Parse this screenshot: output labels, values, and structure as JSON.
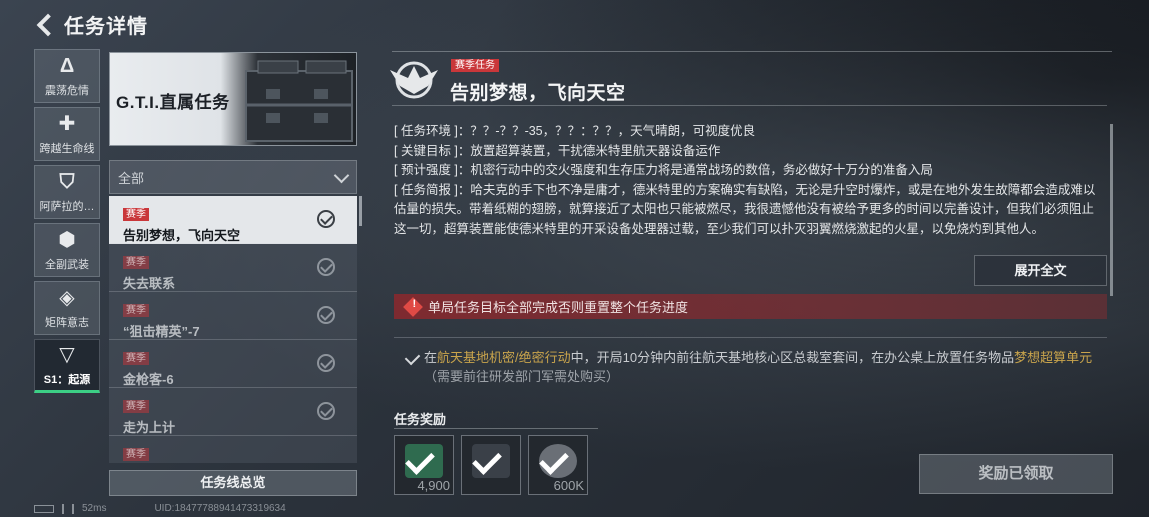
{
  "header": {
    "title": "任务详情"
  },
  "nav": [
    {
      "label": "震荡危情",
      "icon": "delta-icon",
      "glyph": "Δ"
    },
    {
      "label": "跨越生命线",
      "icon": "cross-icon",
      "glyph": "✚"
    },
    {
      "label": "阿萨拉的…",
      "icon": "shield-icon",
      "glyph": "⛉"
    },
    {
      "label": "全副武装",
      "icon": "hexagon-icon",
      "glyph": "⬢"
    },
    {
      "label": "矩阵意志",
      "icon": "diamond-icon",
      "glyph": "◈"
    },
    {
      "label": "S1：起源",
      "icon": "triangle-icon",
      "glyph": "▽"
    }
  ],
  "banner": {
    "title": "G.T.I.直属任务"
  },
  "filter": {
    "label": "全部"
  },
  "tasks": [
    {
      "tag": "赛季",
      "name": "告别梦想，飞向天空"
    },
    {
      "tag": "赛季",
      "name": "失去联系"
    },
    {
      "tag": "赛季",
      "name": "“狙击精英”-7"
    },
    {
      "tag": "赛季",
      "name": "金枪客-6"
    },
    {
      "tag": "赛季",
      "name": "走为上计"
    },
    {
      "tag": "赛季",
      "name": ""
    }
  ],
  "overview_button": "任务线总览",
  "status": {
    "ping": "52ms",
    "uid": "UID:18477788941473319634"
  },
  "detail": {
    "tag": "赛季任务",
    "title": "告别梦想，飞向天空",
    "lines": [
      {
        "key": "[ 任务环境 ]",
        "text": "：？？-？？-35，？？：？？，天气晴朗，可视度优良"
      },
      {
        "key": "[ 关键目标 ]",
        "text": "：放置超算装置，干扰德米特里航天器设备运作"
      },
      {
        "key": "[ 预计强度 ]",
        "text": "：机密行动中的交火强度和生存压力将是通常战场的数倍，务必做好十万分的准备入局"
      },
      {
        "key": "[ 任务简报 ]",
        "text": "：哈夫克的手下也不净是庸才，德米特里的方案确实有缺陷，无论是升空时爆炸，或是在地外发生故障都会造成难以估量的损失。带着纸糊的翅膀，就算接近了太阳也只能被燃尽，我很遗憾他没有被给予更多的时间以完善设计，但我们必须阻止这一切，超算装置能使德米特里的开采设备处理器过载，至少我们可以扑灭羽翼燃烧激起的火星，以免烧灼到其他人。"
      }
    ],
    "expand_button": "展开全文",
    "warning": "单局任务目标全部完成否则重置整个任务进度",
    "objective": {
      "pre": "在",
      "loc": "航天基地机密/绝密行动",
      "mid": "中，开局10分钟内前往航天基地核心区总裁室套间，在办公桌上放置任务物品",
      "item": "梦想超算单元",
      "note": "（需要前往研发部门军需处购买）"
    },
    "reward_title": "任务奖励",
    "rewards": [
      {
        "amount": "4,900",
        "icon": "currency-icon",
        "color": "#2f6b4f"
      },
      {
        "amount": "",
        "icon": "item-case-icon",
        "color": "#3a4048"
      },
      {
        "amount": "600K",
        "icon": "coin-icon",
        "color": "#6a6f76"
      }
    ],
    "claimed_button": "奖励已领取"
  }
}
